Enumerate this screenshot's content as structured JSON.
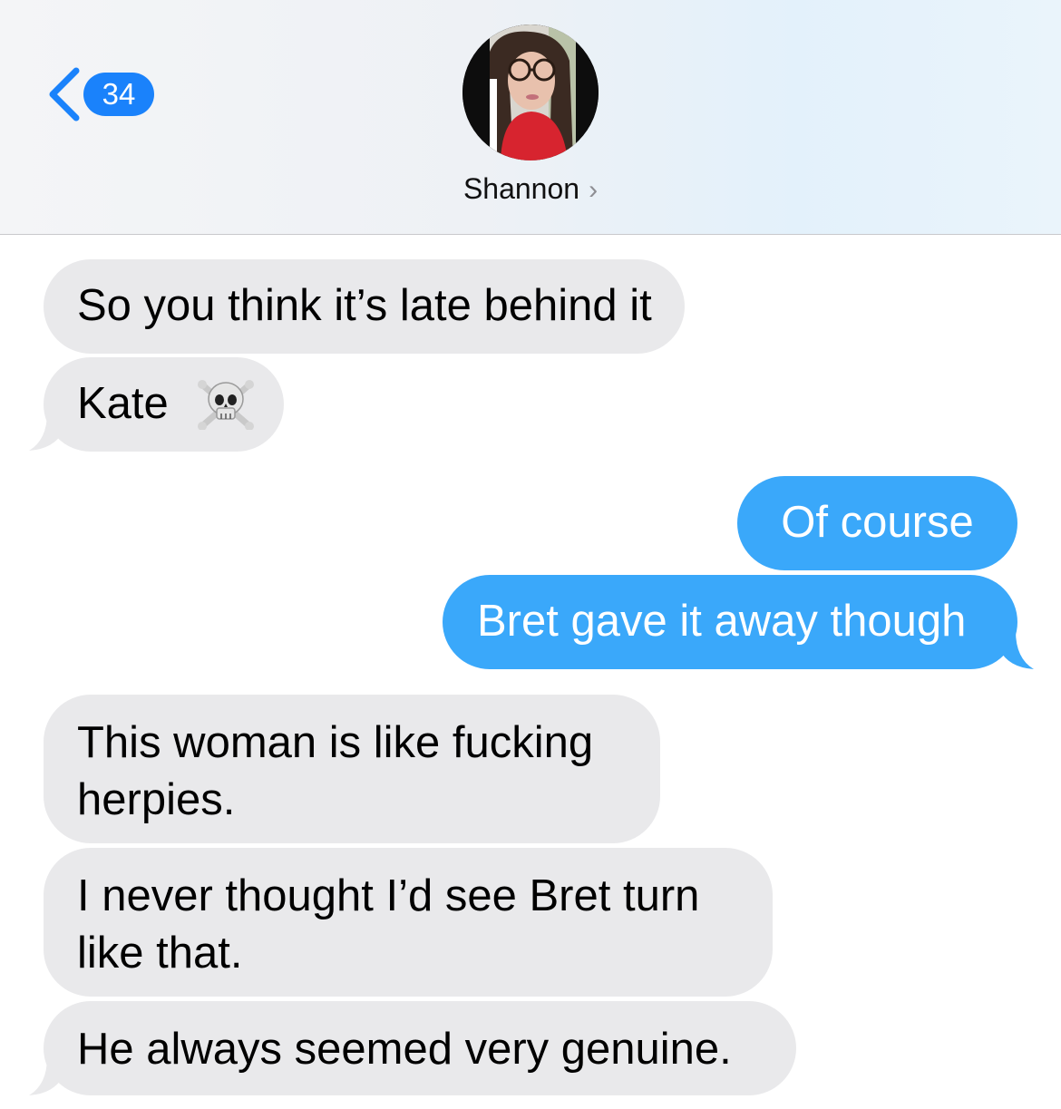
{
  "header": {
    "back_badge_count": "34",
    "contact_name": "Shannon",
    "contact_chevron": "›"
  },
  "icons": {
    "back": "chevron-left-icon",
    "skull": "skull-and-crossbones-icon"
  },
  "colors": {
    "incoming_bubble": "#e9e9eb",
    "outgoing_bubble": "#3aa8fa",
    "badge": "#1a82fb"
  },
  "messages": [
    {
      "from": "contact",
      "text": "So you think it’s late behind it"
    },
    {
      "from": "contact",
      "text": "Kate",
      "emoji": "skull-and-crossbones"
    },
    {
      "from": "me",
      "text": "Of course"
    },
    {
      "from": "me",
      "text": "Bret gave it away though"
    },
    {
      "from": "contact",
      "lines": [
        "This woman is like fucking",
        "herpies."
      ]
    },
    {
      "from": "contact",
      "lines": [
        "I never thought I’d see Bret turn",
        "like that."
      ]
    },
    {
      "from": "contact",
      "text": "He always seemed very genuine."
    }
  ]
}
